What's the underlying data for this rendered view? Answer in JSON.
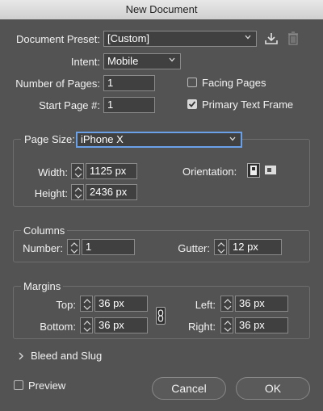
{
  "window": {
    "title": "New Document"
  },
  "preset": {
    "label": "Document Preset:",
    "value": "[Custom]",
    "save_icon": "save-preset-icon",
    "delete_icon": "trash-icon"
  },
  "intent": {
    "label": "Intent:",
    "value": "Mobile"
  },
  "pages": {
    "label": "Number of Pages:",
    "value": "1"
  },
  "start_page": {
    "label": "Start Page #:",
    "value": "1"
  },
  "facing_pages": {
    "label": "Facing Pages",
    "checked": false
  },
  "primary_text_frame": {
    "label": "Primary Text Frame",
    "checked": true
  },
  "page_size": {
    "label": "Page Size:",
    "value": "iPhone X",
    "width_label": "Width:",
    "width": "1125 px",
    "height_label": "Height:",
    "height": "2436 px",
    "orientation_label": "Orientation:",
    "orientation_selected": "portrait"
  },
  "columns": {
    "title": "Columns",
    "number_label": "Number:",
    "number": "1",
    "gutter_label": "Gutter:",
    "gutter": "12 px"
  },
  "margins": {
    "title": "Margins",
    "top_label": "Top:",
    "top": "36 px",
    "bottom_label": "Bottom:",
    "bottom": "36 px",
    "left_label": "Left:",
    "left": "36 px",
    "right_label": "Right:",
    "right": "36 px",
    "link_icon": "chain-link-icon"
  },
  "bleed": {
    "label": "Bleed and Slug"
  },
  "preview": {
    "label": "Preview",
    "checked": false
  },
  "buttons": {
    "cancel": "Cancel",
    "ok": "OK"
  },
  "colors": {
    "panel": "#535353",
    "field": "#404040",
    "focus": "#6aa0e8"
  }
}
